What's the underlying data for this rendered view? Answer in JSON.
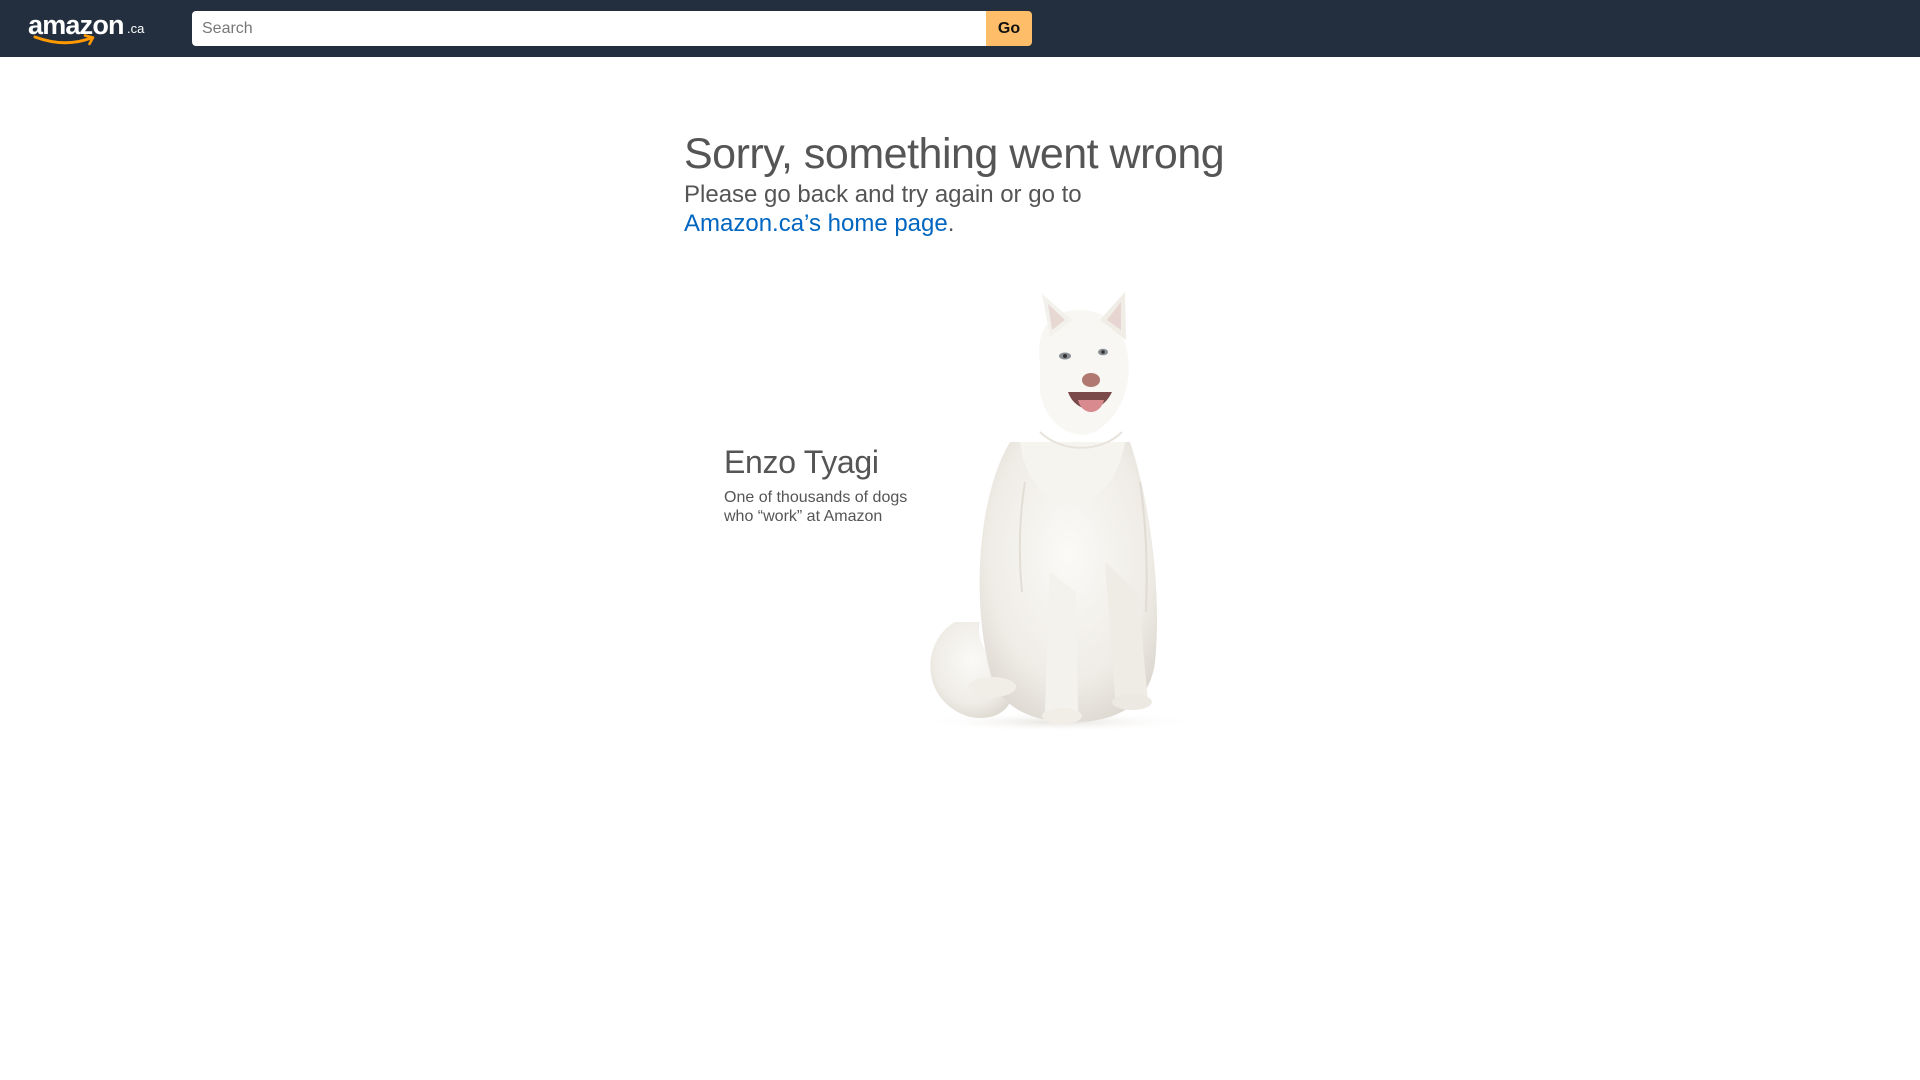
{
  "header": {
    "logo": {
      "wordmark": "amazon",
      "tld": ".ca",
      "icon": "amazon-smile-logo"
    },
    "search": {
      "placeholder": "Search",
      "value": ""
    },
    "go_button": "Go"
  },
  "error": {
    "title": "Sorry, something went wrong",
    "message": "Please go back and try again or go to",
    "link_text": "Amazon.ca’s home page",
    "trailing": "."
  },
  "dog": {
    "name": "Enzo Tyagi",
    "caption_line1": "One of thousands of dogs",
    "caption_line2": "who “work” at Amazon",
    "image": "white-husky-dog-photo"
  },
  "colors": {
    "topbar": "#232f3e",
    "go_button": "#febd69",
    "link": "#0066c0",
    "text": "#555555",
    "smile": "#ff9900"
  }
}
